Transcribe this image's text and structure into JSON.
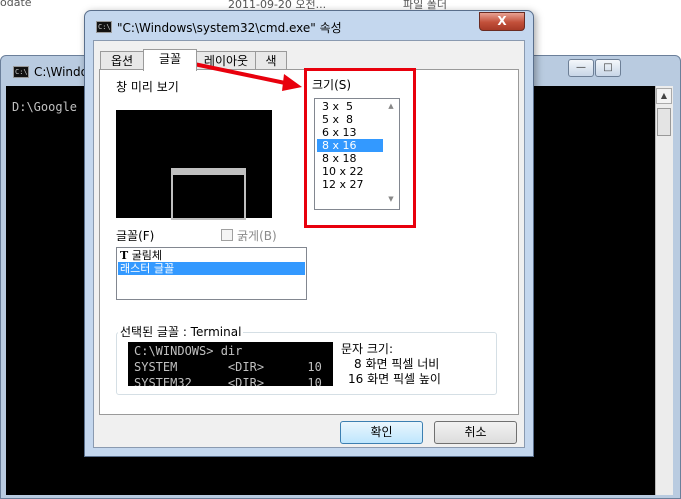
{
  "background": {
    "left_fragment": "odate",
    "date_fragment": "2011-09-20 오전...",
    "type_fragment": "파일 폴더"
  },
  "console": {
    "title": "C:\\Windo",
    "icon_glyph": "C:\\",
    "content": "D:\\Google",
    "min_glyph": "—",
    "max_glyph": "□",
    "scroll_up": "▲"
  },
  "dialog": {
    "title": "\"C:\\Windows\\system32\\cmd.exe\" 속성",
    "close_glyph": "X",
    "tabs": [
      {
        "label": "옵션"
      },
      {
        "label": "글꼴"
      },
      {
        "label": "레이아웃"
      },
      {
        "label": "색"
      }
    ],
    "active_tab": "글꼴",
    "preview_label": "창 미리 보기",
    "size_label": "크기(S)",
    "sizes": [
      "3 x  5",
      "5 x  8",
      "6 x 13",
      "8 x 16",
      "8 x 18",
      "10 x 22",
      "12 x 27"
    ],
    "selected_size": "8 x 16",
    "scroll_up": "▲",
    "scroll_down": "▼",
    "font_label": "글꼴(F)",
    "bold_label": "굵게(B)",
    "bold_checked": false,
    "fonts": [
      {
        "icon": "T",
        "name": "굴림체"
      },
      {
        "icon": "",
        "name": "래스터 글꼴"
      }
    ],
    "selected_font": "래스터 글꼴",
    "selected_font_label": "선택된 글꼴 : Terminal",
    "sample_lines": [
      "C:\\WINDOWS> dir",
      "SYSTEM       <DIR>      10",
      "SYSTEM32     <DIR>      10"
    ],
    "char_size_label": "문자 크기:",
    "char_width": "8 화면 픽셀 너비",
    "char_height": "16 화면 픽셀 높이",
    "ok_label": "확인",
    "cancel_label": "취소"
  },
  "annotation": {
    "color": "#e8000d"
  },
  "colors": {
    "selection": "#3399ff",
    "dialog_frame": "#c4d7ee",
    "console_bg": "#000000"
  }
}
